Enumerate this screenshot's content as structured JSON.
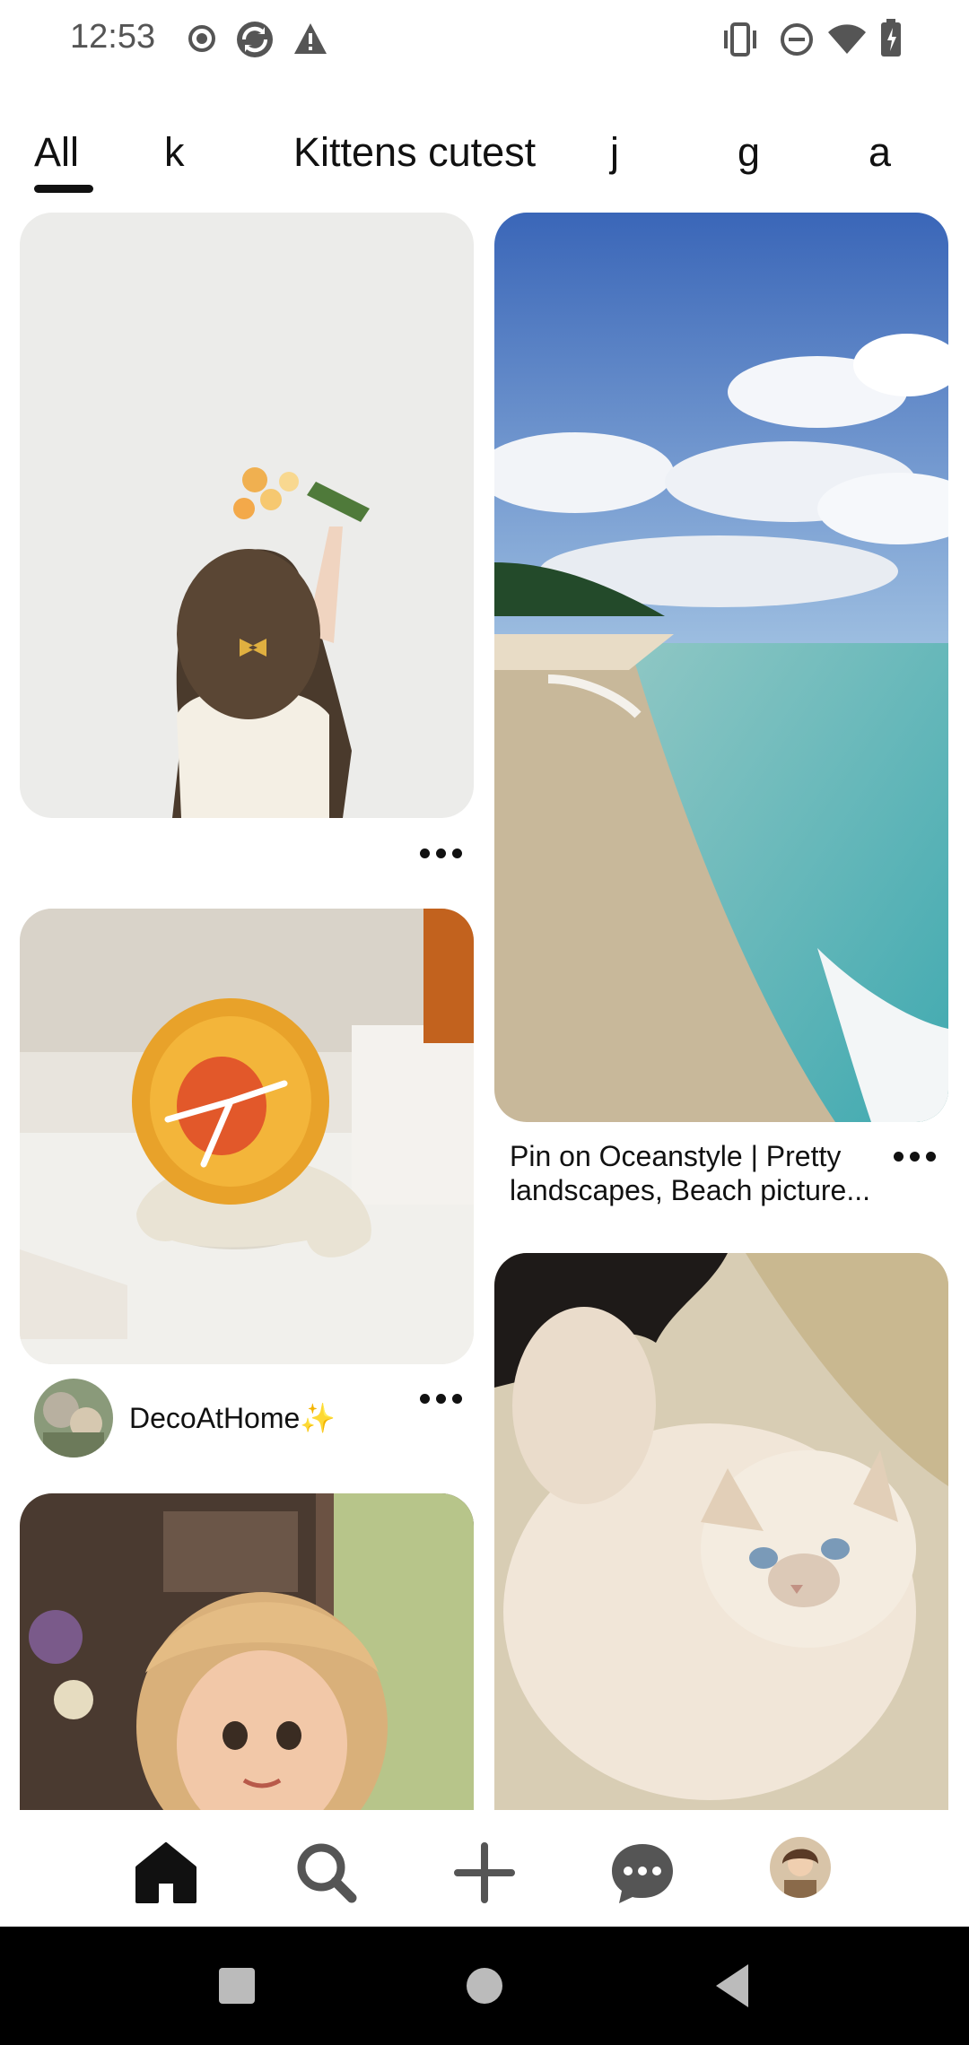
{
  "status_bar": {
    "time": "12:53",
    "left_icons": [
      "record-icon",
      "sync-icon",
      "warning-icon"
    ],
    "right_icons": [
      "vibrate-icon",
      "do-not-disturb-icon",
      "wifi-icon",
      "battery-charging-icon"
    ]
  },
  "tabs": [
    {
      "label": "All",
      "active": true
    },
    {
      "label": "k",
      "active": false
    },
    {
      "label": "Kittens cutest",
      "active": false
    },
    {
      "label": "j",
      "active": false
    },
    {
      "label": "g",
      "active": false
    },
    {
      "label": "a",
      "active": false
    }
  ],
  "feed": {
    "left": [
      {
        "image": "girl-with-flowers-illustration"
      },
      {
        "image": "orange-clock-figurine",
        "creator": "DecoAtHome✨"
      },
      {
        "image": "cartoon-girl-portrait"
      }
    ],
    "right": [
      {
        "image": "beach-ocean-photo",
        "title": "Pin on Oceanstyle | Pretty landscapes, Beach picture..."
      },
      {
        "image": "fluffy-cat-photo"
      }
    ]
  },
  "bottom_nav": [
    "home-icon",
    "search-icon",
    "create-icon",
    "messages-icon",
    "profile-avatar"
  ],
  "colors": {
    "accent": "#111111",
    "background": "#ffffff",
    "system_nav": "#000000"
  }
}
